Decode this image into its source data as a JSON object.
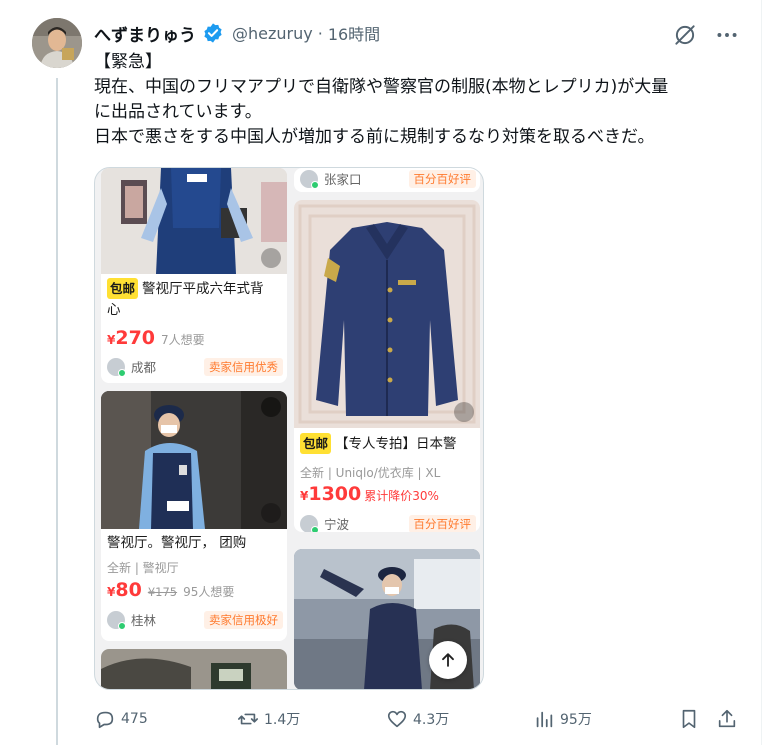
{
  "tweet": {
    "display_name": "へずまりゅう",
    "handle": "@hezuruy",
    "separator": "·",
    "time": "16時間",
    "lines": [
      "【緊急】",
      "現在、中国のフリマアプリで自衛隊や警察官の制服(本物とレプリカ)が大量",
      "に出品されています。",
      "日本で悪さをする中国人が増加する前に規制するなり対策を取るべきだ。"
    ]
  },
  "media": {
    "left": [
      {
        "tag": "包邮",
        "title_line1": "警视厅平成六年式背",
        "title_line2": "心",
        "price_symbol": "¥",
        "price": "270",
        "want": "7人想要",
        "city": "成都",
        "badge": "卖家信用优秀"
      },
      {
        "title": "警视厅。警视厅， 团购",
        "meta": "全新 | 警视厅",
        "price_symbol": "¥",
        "price": "80",
        "old_price": "¥175",
        "want": "95人想要",
        "city": "桂林",
        "badge": "卖家信用极好"
      }
    ],
    "right": [
      {
        "city": "张家口",
        "badge": "百分百好评"
      },
      {
        "tag": "包邮",
        "title": "【专人专拍】日本警",
        "meta": "全新 | Uniqlo/优衣库 | XL",
        "price_symbol": "¥",
        "price": "1300",
        "discount": "累计降价30%",
        "city": "宁波",
        "badge": "百分百好评"
      }
    ]
  },
  "actions": {
    "replies": "475",
    "reposts": "1.4万",
    "likes": "4.3万",
    "views": "95万"
  },
  "colors": {
    "accent": "#1d9bf0",
    "price_red": "#ff3a3a",
    "badge_orange": "#ff7a2e",
    "tag_yellow": "#ffe033"
  },
  "icons": [
    "verified-badge-icon",
    "grok-icon",
    "more-icon",
    "reply-icon",
    "repost-icon",
    "like-icon",
    "views-icon",
    "bookmark-icon",
    "share-icon",
    "scroll-up-icon",
    "image-search-icon",
    "video-play-icon"
  ]
}
